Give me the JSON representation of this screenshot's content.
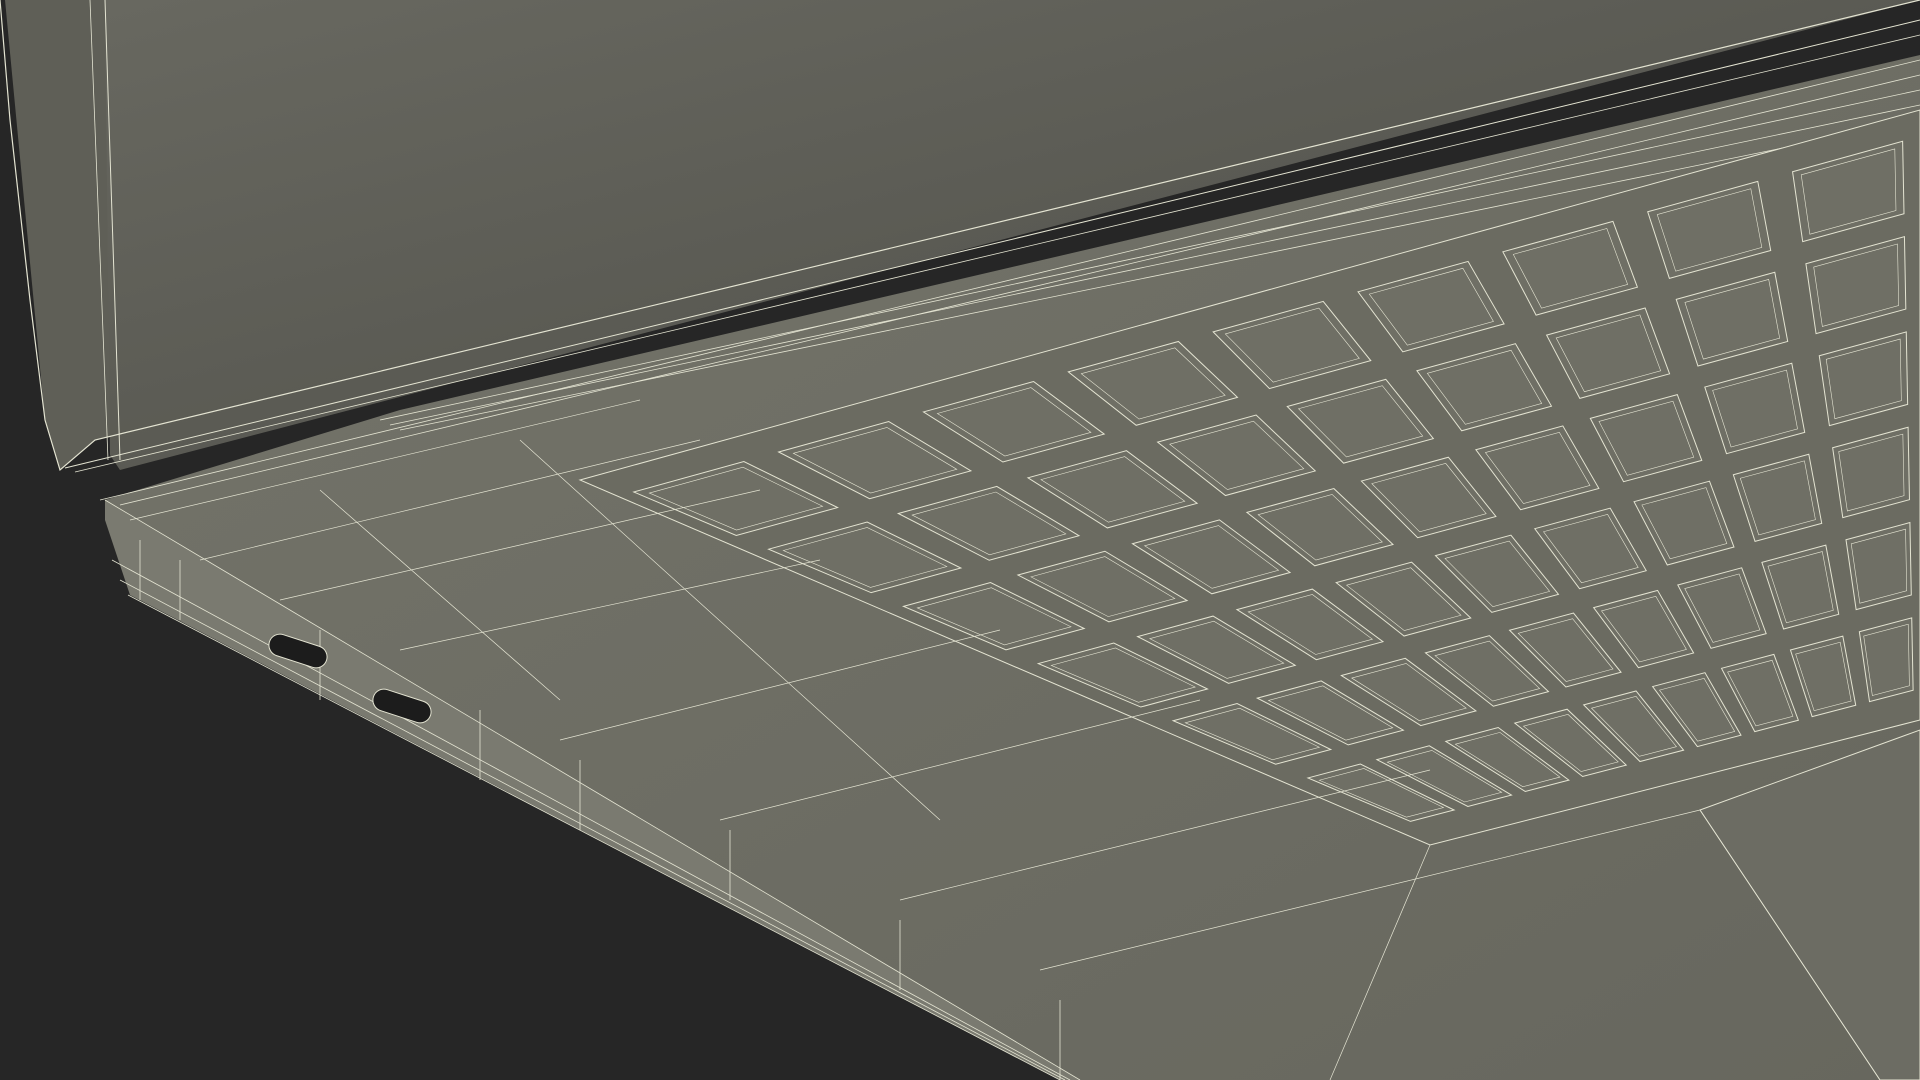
{
  "scene": {
    "subject": "laptop-wireframe-render",
    "colors": {
      "background": "#262626",
      "screen_surface": "#5d5d55",
      "deck_surface": "#6f6f65",
      "edge_surface": "#7a7a70",
      "wire": "#e4e4d2",
      "port": "#1c1c1c"
    },
    "ports": [
      "usb-c-port-1",
      "usb-c-port-2"
    ],
    "keyboard": {
      "visible_rows": 6,
      "visible_columns": 9
    }
  }
}
